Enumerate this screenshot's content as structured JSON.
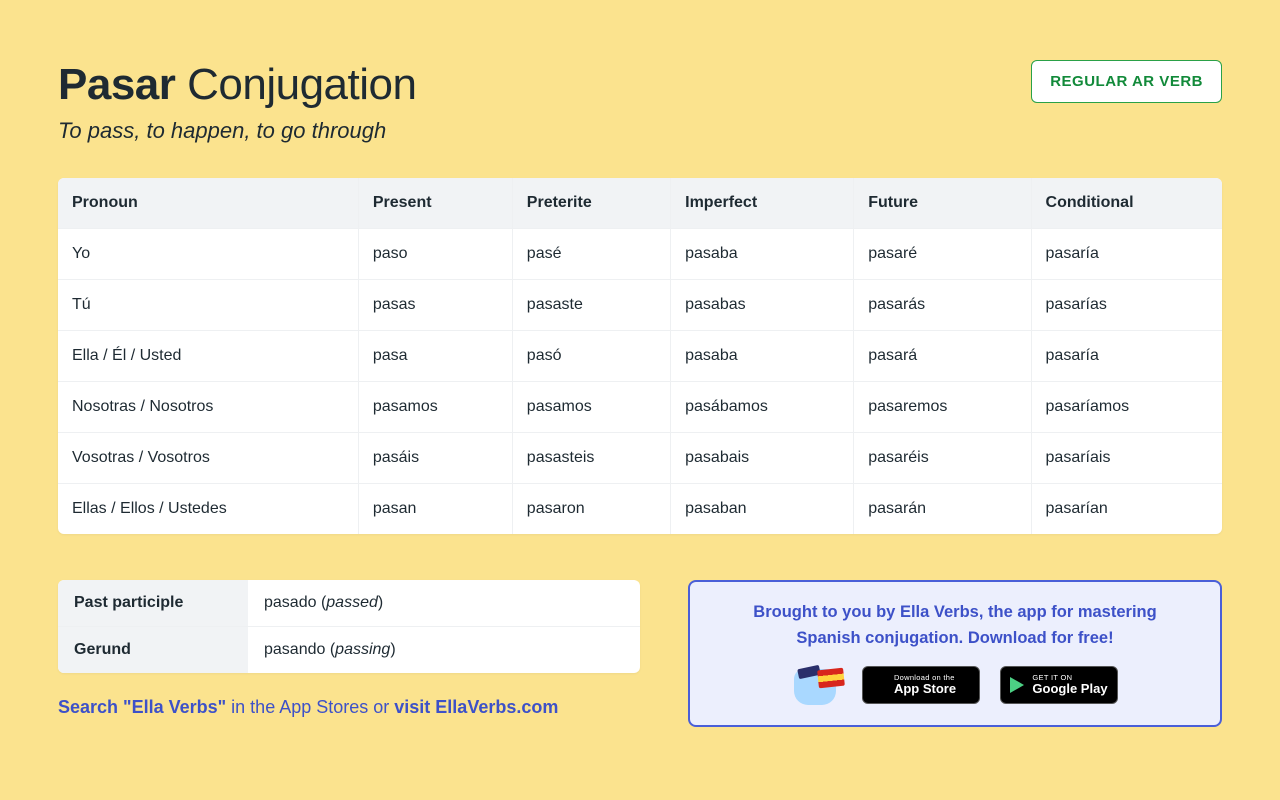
{
  "header": {
    "verb": "Pasar",
    "title_suffix": "Conjugation",
    "subtitle": "To pass, to happen, to go through",
    "badge": "REGULAR AR VERB"
  },
  "table": {
    "headers": [
      "Pronoun",
      "Present",
      "Preterite",
      "Imperfect",
      "Future",
      "Conditional"
    ],
    "rows": [
      [
        "Yo",
        "paso",
        "pasé",
        "pasaba",
        "pasaré",
        "pasaría"
      ],
      [
        "Tú",
        "pasas",
        "pasaste",
        "pasabas",
        "pasarás",
        "pasarías"
      ],
      [
        "Ella / Él / Usted",
        "pasa",
        "pasó",
        "pasaba",
        "pasará",
        "pasaría"
      ],
      [
        "Nosotras / Nosotros",
        "pasamos",
        "pasamos",
        "pasábamos",
        "pasaremos",
        "pasaríamos"
      ],
      [
        "Vosotras / Vosotros",
        "pasáis",
        "pasasteis",
        "pasabais",
        "pasaréis",
        "pasaríais"
      ],
      [
        "Ellas / Ellos / Ustedes",
        "pasan",
        "pasaron",
        "pasaban",
        "pasarán",
        "pasarían"
      ]
    ]
  },
  "forms": {
    "past_participle": {
      "label": "Past participle",
      "es": "pasado",
      "en": "passed"
    },
    "gerund": {
      "label": "Gerund",
      "es": "pasando",
      "en": "passing"
    }
  },
  "promo": {
    "line1": "Brought to you by Ella Verbs, the app for mastering",
    "line2": "Spanish conjugation. Download for free!",
    "appstore_small": "Download on the",
    "appstore_big": "App Store",
    "googleplay_small": "GET IT ON",
    "googleplay_big": "Google Play"
  },
  "search_line": {
    "part1": "Search \"Ella Verbs\"",
    "part2": " in the App Stores or ",
    "part3": "visit EllaVerbs.com"
  }
}
